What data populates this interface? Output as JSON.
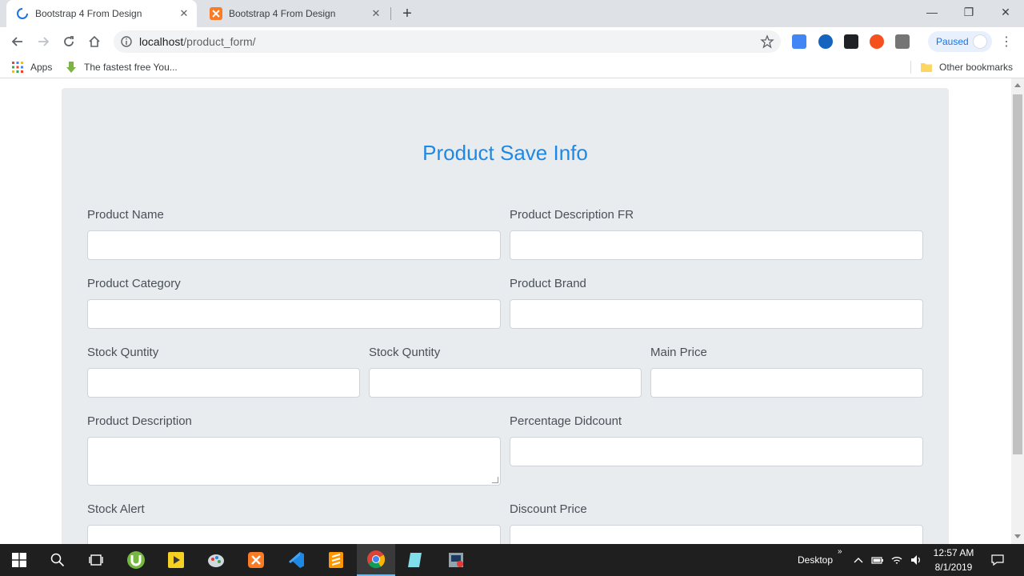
{
  "browser": {
    "tabs": [
      {
        "title": "Bootstrap 4 From Design",
        "active": true
      },
      {
        "title": "Bootstrap 4 From Design",
        "active": false
      }
    ],
    "address": {
      "host": "localhost",
      "path": "/product_form/"
    },
    "profile_label": "Paused",
    "bookmarks": {
      "apps": "Apps",
      "item1": "The fastest free You...",
      "other": "Other bookmarks"
    }
  },
  "form": {
    "heading": "Product Save Info",
    "fields": {
      "product_name": "Product Name",
      "product_description_fr": "Product Description FR",
      "product_category": "Product Category",
      "product_brand": "Product Brand",
      "stock_quantity_1": "Stock Quntity",
      "stock_quantity_2": "Stock Quntity",
      "main_price": "Main Price",
      "product_description": "Product Description",
      "percentage_discount": "Percentage Didcount",
      "stock_alert": "Stock Alert",
      "discount_price": "Discount Price"
    }
  },
  "taskbar": {
    "desktop_label": "Desktop",
    "time": "12:57 AM",
    "date": "8/1/2019"
  },
  "colors": {
    "heading": "#1e88e5",
    "form_bg": "#e9ecef",
    "tab_strip": "#dee1e6",
    "taskbar": "#1f1f1f"
  }
}
